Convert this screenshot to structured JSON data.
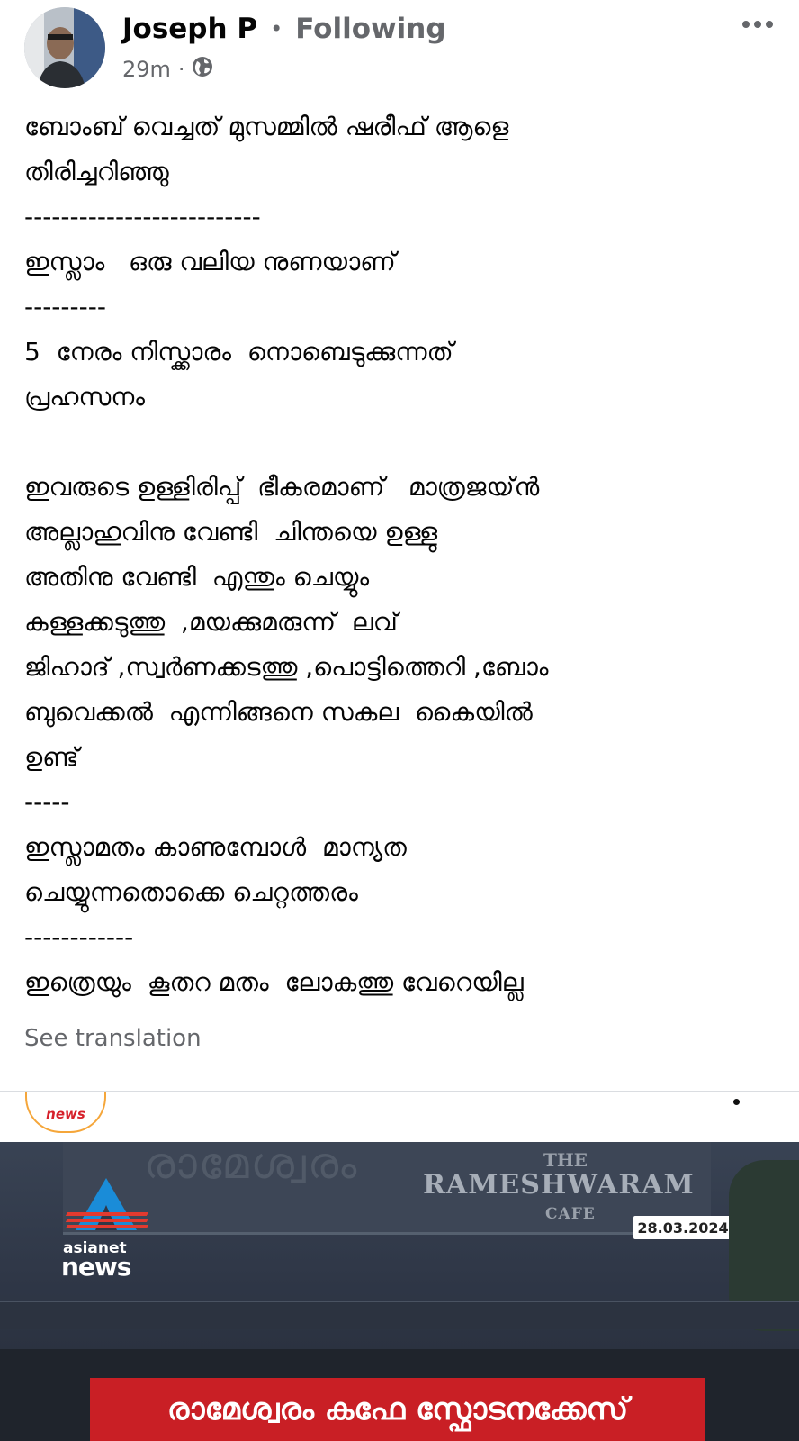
{
  "post": {
    "author": "Joseph P",
    "follow_status": "Following",
    "separator": "•",
    "time": "29m",
    "meta_separator": "·",
    "privacy_icon": "globe-icon",
    "more_icon": "more-options-icon",
    "lines": [
      "ബോംബ് വെച്ചത് മുസമ്മിൽ ഷരീഫ് ആളെ",
      "തിരിച്ചറിഞ്ഞു",
      "--------------------------",
      "ഇസ്ലാം   ഒരു വലിയ നുണയാണ്",
      "---------",
      "5  നേരം നിസ്ക്കാരം  നൊബെടുക്കുന്നത്",
      "പ്രഹസനം",
      "",
      "ഇവരുടെ ഉള്ളിരിപ്പ്  ഭീകരമാണ്   മാത്രജയ്ൻ",
      "അല്ലാഹുവിനു വേണ്ടി  ചിന്തയെ ഉള്ളു",
      "അതിനു വേണ്ടി  എന്തും ചെയ്യും",
      "കള്ളക്കടുത്തു  ,മയക്കുമരുന്ന്  ലവ്",
      "ജിഹാദ് ,സ്വർണക്കടത്തു ,പൊട്ടിത്തെറി ,ബോം",
      "ബുവെക്കൽ  എന്നിങ്ങനെ സകല  കൈയിൽ",
      "ഉണ്ട്",
      "-----",
      "ഇസ്ലാമതം കാണുമ്പോൾ  മാന്യത",
      "ചെയ്യുന്നതൊക്കെ ചെറ്റത്തരം",
      "------------",
      "ഇത്രെയും  കൂതറ മതം  ലോകത്തു വേറെയില്ല"
    ],
    "see_translation": "See translation"
  },
  "media": {
    "embed_logo_text": "news",
    "photo": {
      "sign_faded": "രാമേശ്വരം",
      "brand_the": "THE",
      "brand_main": "RAMESHWARAM",
      "brand_cafe": "CAFE",
      "date": "28.03.2024",
      "channel_line1": "asianet",
      "channel_line2": "news"
    },
    "headline": "രാമേശ്വരം കഫേ സ്ഫോടനക്കേസ്"
  },
  "colors": {
    "secondary_text": "#65676b",
    "headline_red": "#c91f25",
    "asianet_blue": "#1a8cd8",
    "asianet_red": "#e23a2f"
  }
}
